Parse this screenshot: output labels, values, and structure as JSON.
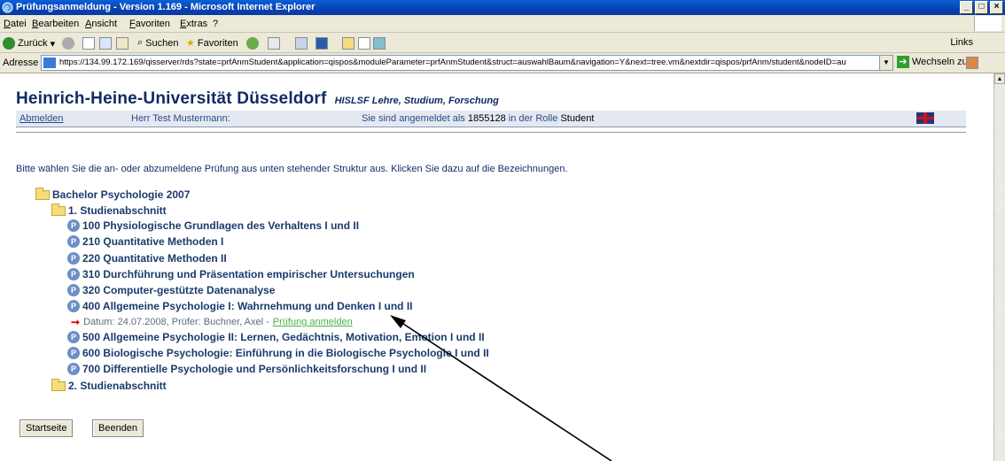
{
  "window": {
    "title": "Prüfungsanmeldung - Version 1.169 - Microsoft Internet Explorer"
  },
  "menu": [
    "Datei",
    "Bearbeiten",
    "Ansicht",
    "Favoriten",
    "Extras",
    "?"
  ],
  "toolbar": {
    "back": "Zurück",
    "search": "Suchen",
    "favorites": "Favoriten",
    "links": "Links"
  },
  "address": {
    "label": "Adresse",
    "url": "https://134.99.172.169/qisserver/rds?state=prfAnmStudent&application=qispos&moduleParameter=prfAnmStudent&struct=auswahlBaum&navigation=Y&next=tree.vm&nextdir=qispos/prfAnm/student&nodeID=au",
    "go": "Wechseln zu"
  },
  "header": {
    "university": "Heinrich-Heine-Universität Düsseldorf",
    "subtitle": "HISLSF Lehre, Studium, Forschung"
  },
  "userbar": {
    "logout": "Abmelden",
    "user": "Herr Test Mustermann:",
    "logged_prefix": "Sie sind angemeldet als",
    "student_number": "1855128",
    "role_prefix": "in der Rolle",
    "role": "Student"
  },
  "instructions": "Bitte wählen Sie die an- oder abzumeldene Prüfung aus unten stehender Struktur aus. Klicken Sie dazu auf die Bezeichnungen.",
  "tree": {
    "root": "Bachelor Psychologie 2007",
    "section1": "1. Studienabschnitt",
    "exams": [
      "100 Physiologische Grundlagen des Verhaltens I und II",
      "210 Quantitative Methoden I",
      "220 Quantitative Methoden II",
      "310 Durchführung und Präsentation empirischer Untersuchungen",
      "320 Computer-gestützte Datenanalyse",
      "400 Allgemeine Psychologie I: Wahrnehmung und Denken I und II",
      "500 Allgemeine Psychologie II: Lernen, Gedächtnis, Motivation, Emotion I und II",
      "600 Biologische Psychologie: Einführung in die Biologische Psychologie I und II",
      "700 Differentielle Psychologie und Persönlichkeitsforschung I und II"
    ],
    "detail": {
      "text": "Datum: 24.07.2008, Prüfer: Buchner, Axel -",
      "link": "Prüfung anmelden"
    },
    "section2": "2. Studienabschnitt"
  },
  "buttons": {
    "start": "Startseite",
    "end": "Beenden"
  }
}
